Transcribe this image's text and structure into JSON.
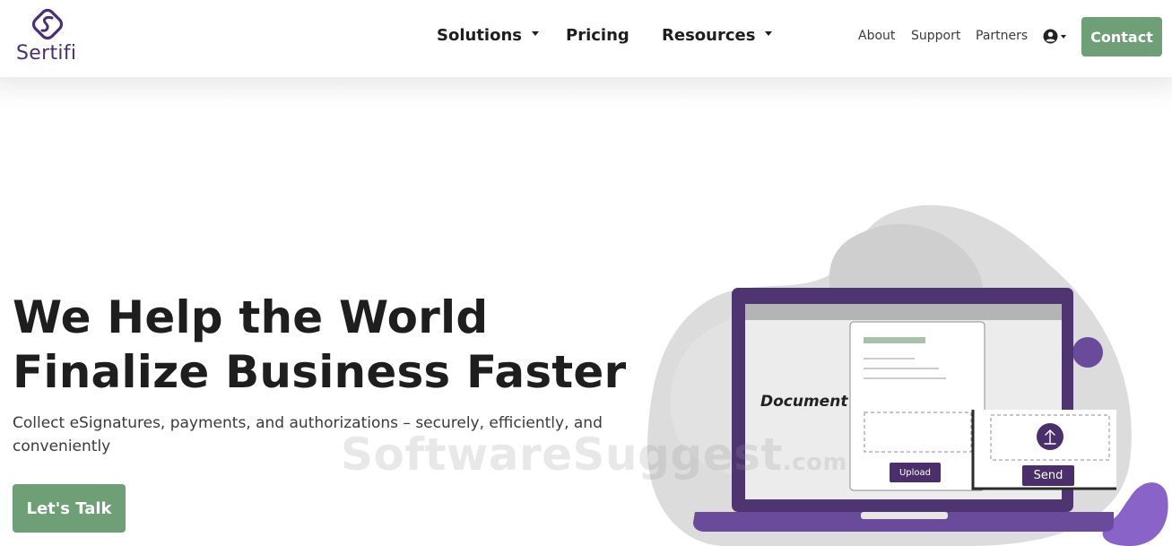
{
  "brand": {
    "name": "Sertifi",
    "logo_icon": "sertifi-s-logo-icon"
  },
  "nav": {
    "main": [
      {
        "label": "Solutions",
        "has_dropdown": true
      },
      {
        "label": "Pricing",
        "has_dropdown": false
      },
      {
        "label": "Resources",
        "has_dropdown": true
      }
    ],
    "utility": [
      {
        "label": "About"
      },
      {
        "label": "Support"
      },
      {
        "label": "Partners"
      }
    ],
    "user_icon": "user-circle-icon",
    "contact_label": "Contact"
  },
  "hero": {
    "title_line1": "We Help the World",
    "title_line2": "Finalize Business Faster",
    "subtitle": "Collect eSignatures, payments, and authorizations – securely, efficiently, and conveniently",
    "cta_label": "Let's Talk"
  },
  "illustration": {
    "document_label": "Document",
    "upload_label": "Upload",
    "send_label": "Send"
  },
  "watermark": {
    "main": "SoftwareSuggest",
    "suffix": ".com"
  },
  "colors": {
    "brand_purple": "#4b2f73",
    "accent_green": "#6f9f76",
    "laptop_purple": "#4e3470",
    "blob_gray": "#dcdcdc",
    "text_dark": "#1e1e1e"
  }
}
